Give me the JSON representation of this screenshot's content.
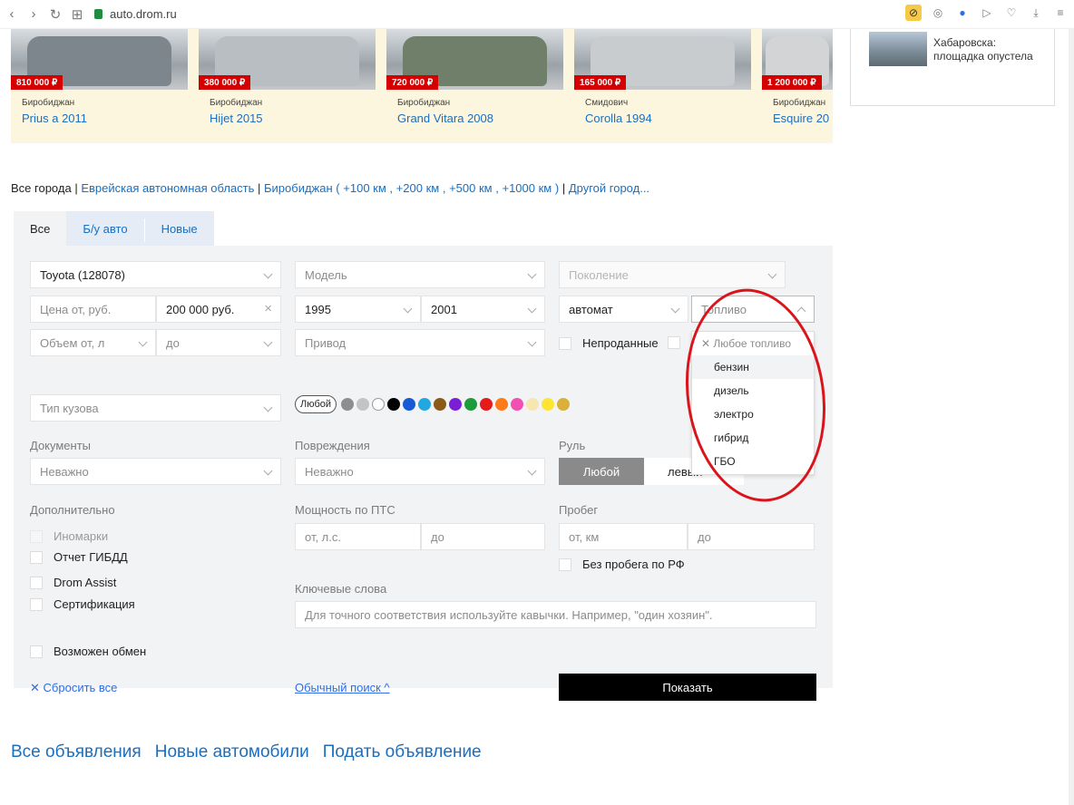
{
  "browser": {
    "url": "auto.drom.ru"
  },
  "cars": [
    {
      "price": "810 000 ₽",
      "city": "Биробиджан",
      "model": "Prius a 2011"
    },
    {
      "price": "380 000 ₽",
      "city": "Биробиджан",
      "model": "Hijet 2015"
    },
    {
      "price": "720 000 ₽",
      "city": "Биробиджан",
      "model": "Grand Vitara 2008"
    },
    {
      "price": "165 000 ₽",
      "city": "Смидович",
      "model": "Corolla 1994"
    },
    {
      "price": "1 200 000 ₽",
      "city": "Биробиджан",
      "model": "Esquire 20"
    }
  ],
  "news": {
    "text": "Хабаровска: площадка опустела"
  },
  "cities": {
    "all": "Все города",
    "region": "Еврейская автономная область",
    "city": "Биробиджан",
    "r100": "+100 км",
    "r200": "+200 км",
    "r500": "+500 км",
    "r1000": "+1000 км",
    "other": "Другой город..."
  },
  "tabs": [
    "Все",
    "Б/у авто",
    "Новые"
  ],
  "filters": {
    "brand": "Toyota (128078)",
    "model": "Модель",
    "generation": "Поколение",
    "price_from": "Цена от, руб.",
    "price_to": "200 000 руб.",
    "year_from": "1995",
    "year_to": "2001",
    "transmission": "автомат",
    "fuel": "Топливо",
    "volume_from": "Объем от, л",
    "volume_to": "до",
    "drive": "Привод",
    "unsold": "Непроданные",
    "body": "Тип кузова",
    "color_any": "Любой",
    "documents_label": "Документы",
    "documents": "Неважно",
    "damage_label": "Повреждения",
    "damage": "Неважно",
    "wheel_label": "Руль",
    "wheel_any": "Любой",
    "wheel_left": "левый",
    "extra_label": "Дополнительно",
    "extra": [
      "Иномарки",
      "Отчет ГИБДД",
      "Drom Assist",
      "Сертификация"
    ],
    "power_label": "Мощность по ПТС",
    "power_from": "от, л.с.",
    "power_to": "до",
    "mileage_label": "Пробег",
    "mileage_from": "от, км",
    "mileage_to": "до",
    "no_mileage_rf": "Без пробега по РФ",
    "keywords_label": "Ключевые слова",
    "keywords_placeholder": "Для точного соответствия используйте кавычки. Например, \"один хозяин\".",
    "exchange": "Возможен обмен",
    "reset": "Сбросить все",
    "normal_search": "Обычный поиск",
    "show": "Показать"
  },
  "colors": [
    "#8e8e8e",
    "#c4c4c4",
    "#ffffff",
    "#000000",
    "#1759d6",
    "#21a8e0",
    "#8a5a19",
    "#7b1fd6",
    "#1e9c3a",
    "#e31b1b",
    "#ff7a1a",
    "#f24fb2",
    "#f6e7b0",
    "#ffe433",
    "#d8b03a"
  ],
  "fuel_dropdown": {
    "header": "Любое топливо",
    "options": [
      "бензин",
      "дизель",
      "электро",
      "гибрид",
      "ГБО"
    ]
  },
  "bottom_links": [
    "Все объявления",
    "Новые автомобили",
    "Подать объявление"
  ]
}
